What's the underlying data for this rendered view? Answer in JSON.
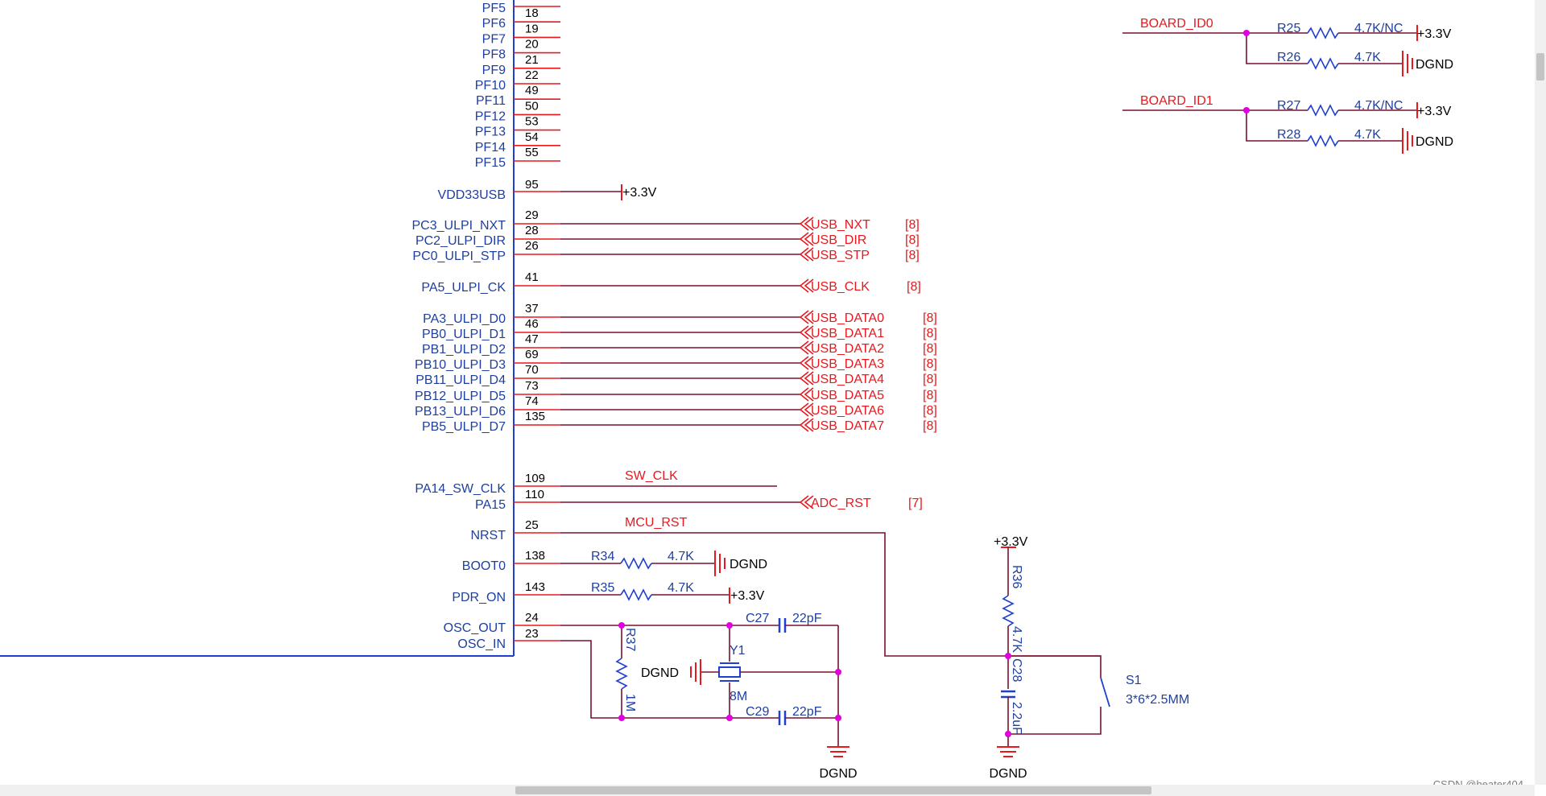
{
  "colors": {
    "wire": "#7a1030",
    "pin": "#e8181e",
    "body": "#1f3fd0",
    "junction": "#e000e0",
    "netlabel": "#e8181e",
    "text": "#1f3f9f"
  },
  "pins": [
    {
      "name": "PF5",
      "num": ""
    },
    {
      "name": "PF6",
      "num": "18"
    },
    {
      "name": "PF7",
      "num": "19"
    },
    {
      "name": "PF8",
      "num": "20"
    },
    {
      "name": "PF9",
      "num": "21"
    },
    {
      "name": "PF10",
      "num": "22"
    },
    {
      "name": "PF11",
      "num": "49"
    },
    {
      "name": "PF12",
      "num": "50"
    },
    {
      "name": "PF13",
      "num": "53"
    },
    {
      "name": "PF14",
      "num": "54"
    },
    {
      "name": "PF15",
      "num": "55"
    }
  ],
  "mcu": {
    "vdd": {
      "name": "VDD33USB",
      "num": "95",
      "power": "+3.3V"
    },
    "ulpi": [
      {
        "name": "PC3_ULPI_NXT",
        "num": "29",
        "net": "USB_NXT",
        "sheet": "[8]"
      },
      {
        "name": "PC2_ULPI_DIR",
        "num": "28",
        "net": "USB_DIR",
        "sheet": "[8]"
      },
      {
        "name": "PC0_ULPI_STP",
        "num": "26",
        "net": "USB_STP",
        "sheet": "[8]"
      },
      {
        "name": "PA5_ULPI_CK",
        "num": "41",
        "net": "USB_CLK",
        "sheet": "[8]"
      }
    ],
    "data": [
      {
        "name": "PA3_ULPI_D0",
        "num": "37",
        "net": "USB_DATA0",
        "sheet": "[8]"
      },
      {
        "name": "PB0_ULPI_D1",
        "num": "46",
        "net": "USB_DATA1",
        "sheet": "[8]"
      },
      {
        "name": "PB1_ULPI_D2",
        "num": "47",
        "net": "USB_DATA2",
        "sheet": "[8]"
      },
      {
        "name": "PB10_ULPI_D3",
        "num": "69",
        "net": "USB_DATA3",
        "sheet": "[8]"
      },
      {
        "name": "PB11_ULPI_D4",
        "num": "70",
        "net": "USB_DATA4",
        "sheet": "[8]"
      },
      {
        "name": "PB12_ULPI_D5",
        "num": "73",
        "net": "USB_DATA5",
        "sheet": "[8]"
      },
      {
        "name": "PB13_ULPI_D6",
        "num": "74",
        "net": "USB_DATA6",
        "sheet": "[8]"
      },
      {
        "name": "PB5_ULPI_D7",
        "num": "135",
        "net": "USB_DATA7",
        "sheet": "[8]"
      }
    ],
    "swclk": {
      "name": "PA14_SW_CLK",
      "num": "109",
      "net": "SW_CLK"
    },
    "pa15": {
      "name": "PA15",
      "num": "110",
      "net": "ADC_RST",
      "sheet": "[7]"
    },
    "nrst": {
      "name": "NRST",
      "num": "25",
      "net": "MCU_RST"
    },
    "boot0": {
      "name": "BOOT0",
      "num": "138"
    },
    "pdr": {
      "name": "PDR_ON",
      "num": "143"
    },
    "oscout": {
      "name": "OSC_OUT",
      "num": "24"
    },
    "oscin": {
      "name": "OSC_IN",
      "num": "23"
    }
  },
  "board_id": [
    {
      "net": "BOARD_ID0",
      "r_up": "R25",
      "r_up_val": "4.7K/NC",
      "r_up_pwr": "+3.3V",
      "r_dn": "R26",
      "r_dn_val": "4.7K",
      "r_dn_gnd": "DGND"
    },
    {
      "net": "BOARD_ID1",
      "r_up": "R27",
      "r_up_val": "4.7K/NC",
      "r_up_pwr": "+3.3V",
      "r_dn": "R28",
      "r_dn_val": "4.7K",
      "r_dn_gnd": "DGND"
    }
  ],
  "boot": {
    "r34": "R34",
    "r34_val": "4.7K",
    "gnd": "DGND",
    "r35": "R35",
    "r35_val": "4.7K",
    "pwr": "+3.3V"
  },
  "osc": {
    "r37": "R37",
    "r37_val": "1M",
    "c27": "C27",
    "c27_val": "22pF",
    "c29": "C29",
    "c29_val": "22pF",
    "y1": "Y1",
    "y1_val": "8M",
    "gnd_left": "DGND",
    "gnd_bottom": "DGND"
  },
  "reset": {
    "pwr": "+3.3V",
    "r36": "R36",
    "r36_val": "4.7K",
    "c28": "C28",
    "c28_val": "2.2uF",
    "s1": "S1",
    "s1_val": "3*6*2.5MM",
    "gnd": "DGND"
  },
  "watermark": "CSDN @heater404"
}
